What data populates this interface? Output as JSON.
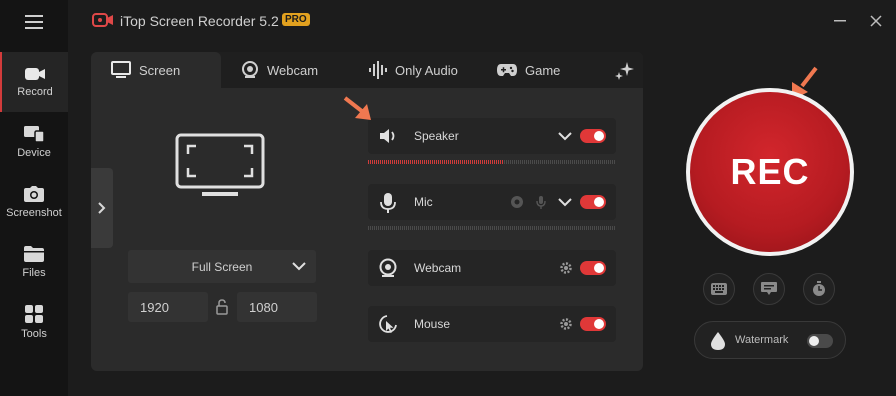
{
  "app": {
    "title": "iTop Screen Recorder 5.2",
    "badge": "PRO",
    "accent": "#d23b3b",
    "badge_color": "#e2a11f"
  },
  "sidebar": {
    "items": [
      {
        "label": "Record",
        "icon": "video-camera-icon",
        "active": true
      },
      {
        "label": "Device",
        "icon": "device-icon",
        "active": false
      },
      {
        "label": "Screenshot",
        "icon": "camera-icon",
        "active": false
      },
      {
        "label": "Files",
        "icon": "folder-icon",
        "active": false
      },
      {
        "label": "Tools",
        "icon": "grid-icon",
        "active": false
      }
    ]
  },
  "tabs": [
    {
      "label": "Screen",
      "icon": "monitor-icon",
      "active": true
    },
    {
      "label": "Webcam",
      "icon": "webcam-icon",
      "active": false
    },
    {
      "label": "Only Audio",
      "icon": "audio-wave-icon",
      "active": false
    },
    {
      "label": "Game",
      "icon": "gamepad-icon",
      "active": false
    }
  ],
  "screen": {
    "mode": "Full Screen",
    "width": "1920",
    "height": "1080"
  },
  "sources": {
    "speaker": {
      "label": "Speaker",
      "enabled": true,
      "level": 0.55
    },
    "mic": {
      "label": "Mic",
      "enabled": true,
      "level": 0
    },
    "webcam": {
      "label": "Webcam",
      "enabled": true
    },
    "mouse": {
      "label": "Mouse",
      "enabled": true
    }
  },
  "record": {
    "label": "REC"
  },
  "watermark": {
    "label": "Watermark",
    "enabled": false
  }
}
